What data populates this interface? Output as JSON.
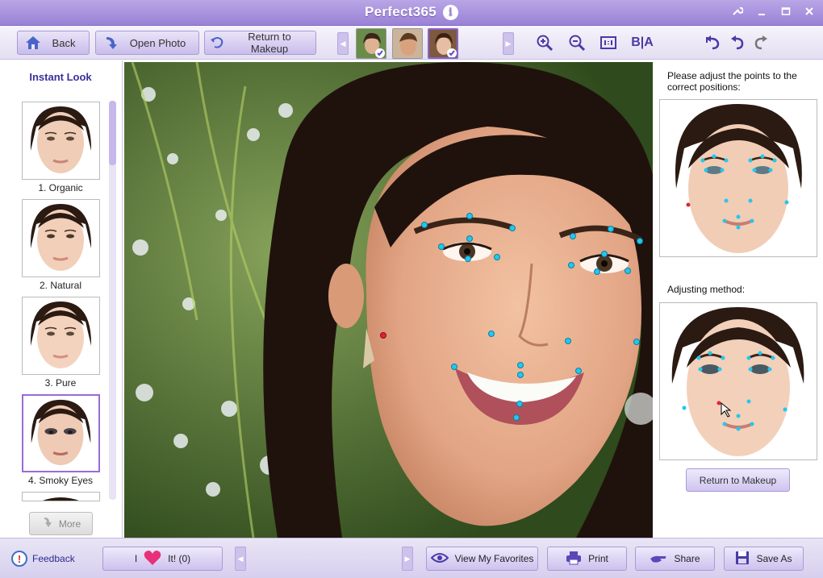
{
  "window": {
    "title": "Perfect365"
  },
  "toolbar": {
    "back_label": "Back",
    "open_photo_label": "Open Photo",
    "return_to_makeup_label": "Return to Makeup",
    "before_after_label": "B|A"
  },
  "left_panel": {
    "heading": "Instant Look",
    "looks": [
      {
        "label": "1. Organic"
      },
      {
        "label": "2. Natural"
      },
      {
        "label": "3. Pure"
      },
      {
        "label": "4. Smoky Eyes"
      }
    ],
    "more_label": "More"
  },
  "right_panel": {
    "instruction_line1": "Please adjust the points to the",
    "instruction_line2": "correct positions:",
    "adjusting_label": "Adjusting method:",
    "return_button_label": "Return to Makeup"
  },
  "bottom_bar": {
    "feedback_label": "Feedback",
    "love_prefix": "I",
    "love_suffix": "It! (0)",
    "favorites_label": "View My Favorites",
    "print_label": "Print",
    "share_label": "Share",
    "save_as_label": "Save As"
  },
  "colors": {
    "accent": "#9a82d6",
    "point": "#22c8ee",
    "point_selected": "#e0223b"
  }
}
